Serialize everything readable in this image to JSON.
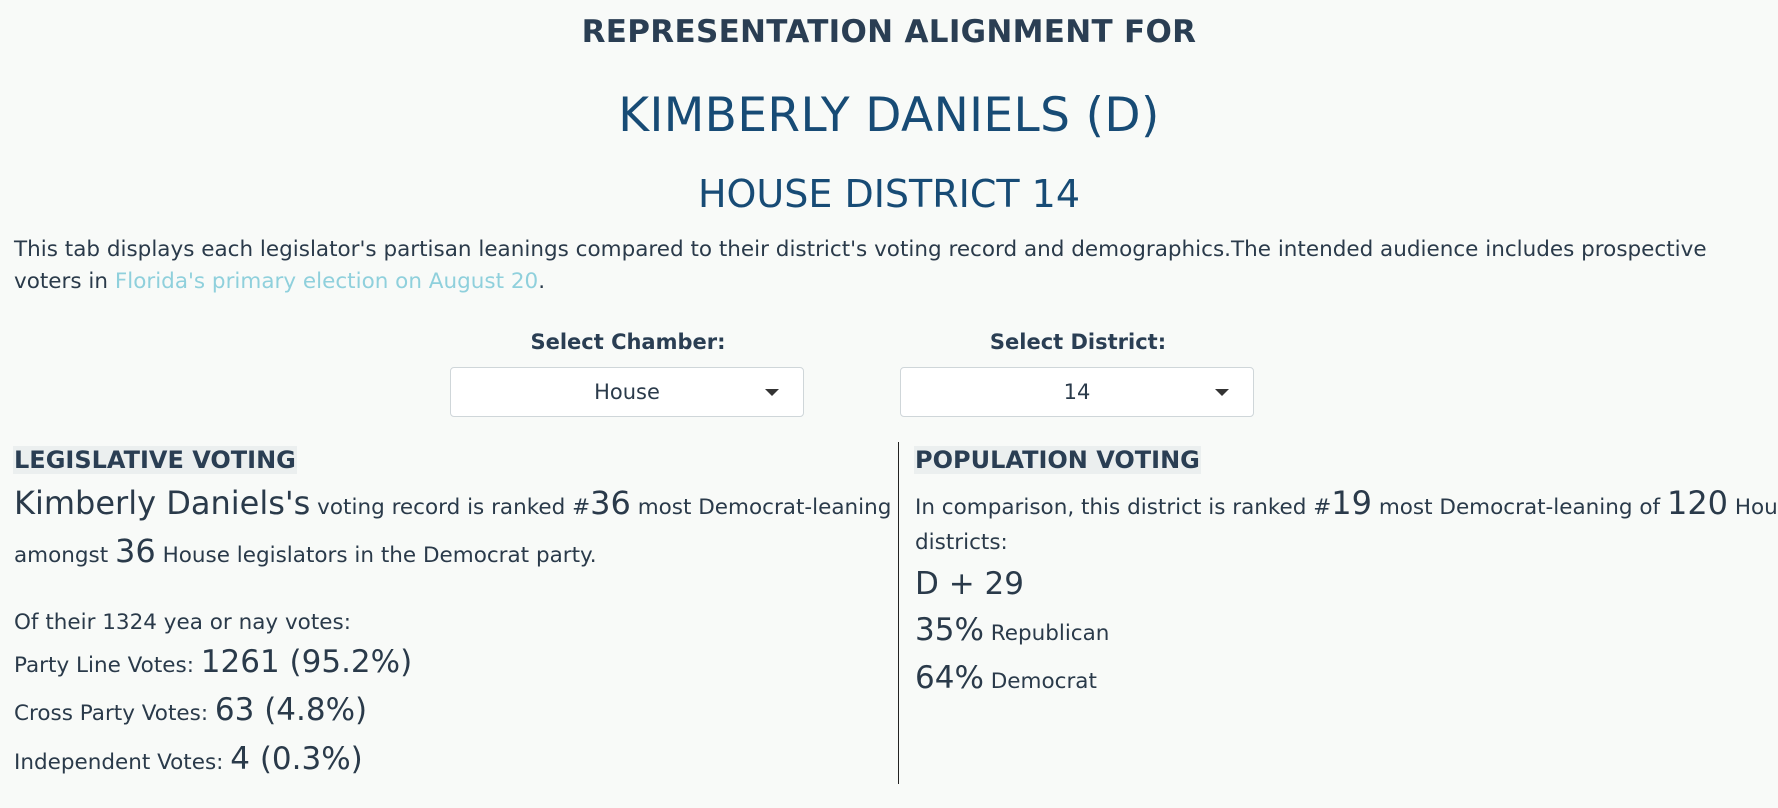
{
  "header": {
    "eyebrow": "REPRESENTATION ALIGNMENT FOR",
    "name": "KIMBERLY DANIELS (D)",
    "district": "HOUSE DISTRICT 14"
  },
  "intro": {
    "text": "This tab displays each legislator's partisan leanings compared to their district's voting record and demographics.The intended audience includes prospective voters in ",
    "link": "Florida's primary election on August 20",
    "end": "."
  },
  "chamber_select": {
    "label": "Select Chamber:",
    "value": "House"
  },
  "district_select": {
    "label": "Select District:",
    "value": "14"
  },
  "legislative": {
    "title": "LEGISLATIVE VOTING",
    "name": "Kimberly Daniels's",
    "t1": " voting record is ranked #",
    "rank": "36",
    "t2": " most Democrat-leaning",
    "t3": "amongst ",
    "total": "36",
    "t4": " House legislators in the Democrat party.",
    "votes_intro": "Of their 1324 yea or nay votes:",
    "party_line_label": "Party Line Votes: ",
    "party_line_value": "1261 (95.2%)",
    "cross_label": "Cross Party Votes: ",
    "cross_value": "63 (4.8%)",
    "independent_label": "Independent Votes: ",
    "independent_value": "4 (0.3%)"
  },
  "population": {
    "title": "POPULATION VOTING",
    "t1": "In comparison, this district is ranked #",
    "rank": "19",
    "t2": " most Democrat-leaning of ",
    "total": "120",
    "t3": " House",
    "t4": "districts:",
    "lean": "D + 29",
    "rep_pct": "35%",
    "rep_label": " Republican",
    "dem_pct": "64%",
    "dem_label": " Democrat"
  }
}
